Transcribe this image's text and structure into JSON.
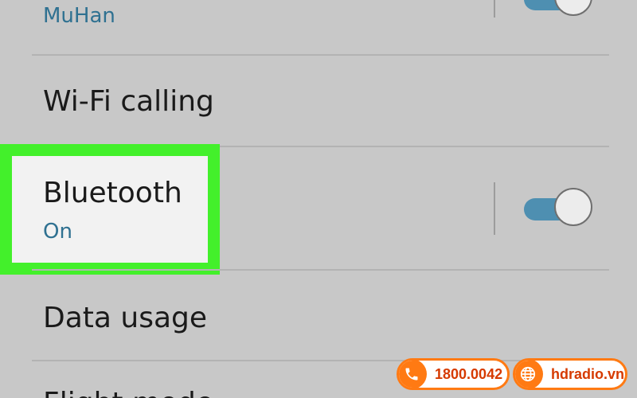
{
  "settings": {
    "network_name": "MuHan",
    "wifi_calling_label": "Wi-Fi calling",
    "bluetooth": {
      "label": "Bluetooth",
      "status": "On",
      "enabled": true
    },
    "data_usage_label": "Data usage",
    "next_item_partial_label": "Flight mode"
  },
  "watermark": {
    "phone": "1800.0042",
    "website": "hdradio.vn",
    "phone_icon": "phone-icon",
    "web_icon": "globe-icon"
  },
  "colors": {
    "background": "#c8c8c8",
    "highlight_border": "#43f02b",
    "toggle_track": "#4e8fb1",
    "subtext": "#2f7191",
    "badge_orange": "#ff7a13"
  }
}
